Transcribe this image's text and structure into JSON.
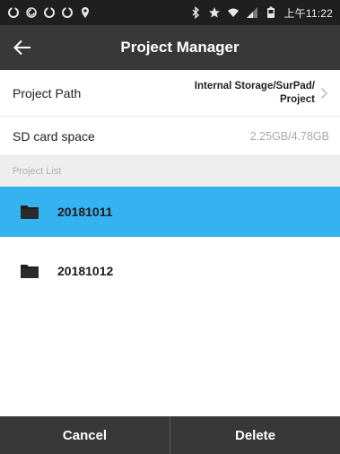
{
  "status_bar": {
    "time": "上午11:22",
    "icons": [
      "notification-icon",
      "notification-icon",
      "notification-icon",
      "notification-icon",
      "location-icon",
      "bluetooth-icon",
      "star-icon",
      "wifi-icon",
      "signal-icon",
      "battery-icon"
    ]
  },
  "app_bar": {
    "title": "Project Manager",
    "back_icon": "arrow-left-icon"
  },
  "settings": {
    "project_path": {
      "label": "Project Path",
      "value_line1": "Internal Storage/SurPad/",
      "value_line2": "Project"
    },
    "sd_card": {
      "label": "SD card space",
      "value": "2.25GB/4.78GB"
    }
  },
  "project_list": {
    "header": "Project List",
    "items": [
      {
        "name": "20181011",
        "selected": true
      },
      {
        "name": "20181012",
        "selected": false
      }
    ]
  },
  "buttons": {
    "cancel": "Cancel",
    "delete": "Delete"
  },
  "colors": {
    "status_bar": "#1f1f1f",
    "app_bar": "#383838",
    "selected": "#35b2f0",
    "section_header": "#eeeeee"
  }
}
